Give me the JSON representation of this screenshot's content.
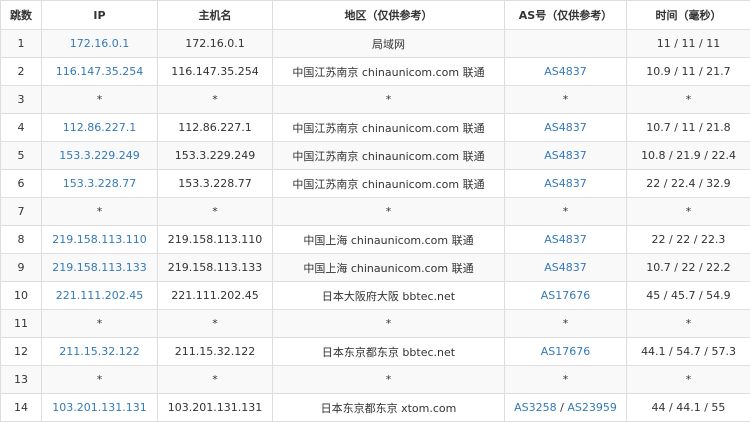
{
  "table": {
    "headers": {
      "hop": "跳数",
      "ip": "IP",
      "hostname": "主机名",
      "location": "地区（仅供参考）",
      "asn": "AS号（仅供参考）",
      "time": "时间（毫秒）"
    },
    "rows": [
      {
        "hop": "1",
        "ip": "172.16.0.1",
        "hostname": "172.16.0.1",
        "location": "局域网",
        "asn": [],
        "time": "11 / 11 / 11"
      },
      {
        "hop": "2",
        "ip": "116.147.35.254",
        "hostname": "116.147.35.254",
        "location": "中国江苏南京 chinaunicom.com 联通",
        "asn": [
          "AS4837"
        ],
        "time": "10.9 / 11 / 21.7"
      },
      {
        "hop": "3",
        "ip": "*",
        "hostname": "*",
        "location": "*",
        "asn": [
          "*"
        ],
        "time": "*"
      },
      {
        "hop": "4",
        "ip": "112.86.227.1",
        "hostname": "112.86.227.1",
        "location": "中国江苏南京 chinaunicom.com 联通",
        "asn": [
          "AS4837"
        ],
        "time": "10.7 / 11 / 21.8"
      },
      {
        "hop": "5",
        "ip": "153.3.229.249",
        "hostname": "153.3.229.249",
        "location": "中国江苏南京 chinaunicom.com 联通",
        "asn": [
          "AS4837"
        ],
        "time": "10.8 / 21.9 / 22.4"
      },
      {
        "hop": "6",
        "ip": "153.3.228.77",
        "hostname": "153.3.228.77",
        "location": "中国江苏南京 chinaunicom.com 联通",
        "asn": [
          "AS4837"
        ],
        "time": "22 / 22.4 / 32.9"
      },
      {
        "hop": "7",
        "ip": "*",
        "hostname": "*",
        "location": "*",
        "asn": [
          "*"
        ],
        "time": "*"
      },
      {
        "hop": "8",
        "ip": "219.158.113.110",
        "hostname": "219.158.113.110",
        "location": "中国上海 chinaunicom.com 联通",
        "asn": [
          "AS4837"
        ],
        "time": "22 / 22 / 22.3"
      },
      {
        "hop": "9",
        "ip": "219.158.113.133",
        "hostname": "219.158.113.133",
        "location": "中国上海 chinaunicom.com 联通",
        "asn": [
          "AS4837"
        ],
        "time": "10.7 / 22 / 22.2"
      },
      {
        "hop": "10",
        "ip": "221.111.202.45",
        "hostname": "221.111.202.45",
        "location": "日本大阪府大阪 bbtec.net",
        "asn": [
          "AS17676"
        ],
        "time": "45 / 45.7 / 54.9"
      },
      {
        "hop": "11",
        "ip": "*",
        "hostname": "*",
        "location": "*",
        "asn": [
          "*"
        ],
        "time": "*"
      },
      {
        "hop": "12",
        "ip": "211.15.32.122",
        "hostname": "211.15.32.122",
        "location": "日本东京都东京 bbtec.net",
        "asn": [
          "AS17676"
        ],
        "time": "44.1 / 54.7 / 57.3"
      },
      {
        "hop": "13",
        "ip": "*",
        "hostname": "*",
        "location": "*",
        "asn": [
          "*"
        ],
        "time": "*"
      },
      {
        "hop": "14",
        "ip": "103.201.131.131",
        "hostname": "103.201.131.131",
        "location": "日本东京都东京 xtom.com",
        "asn": [
          "AS3258",
          "AS23959"
        ],
        "time": "44 / 44.1 / 55"
      }
    ]
  },
  "colors": {
    "link": "#337ab7",
    "text": "#333333",
    "border": "#dddddd",
    "row_alt": "#f9f9f9"
  }
}
